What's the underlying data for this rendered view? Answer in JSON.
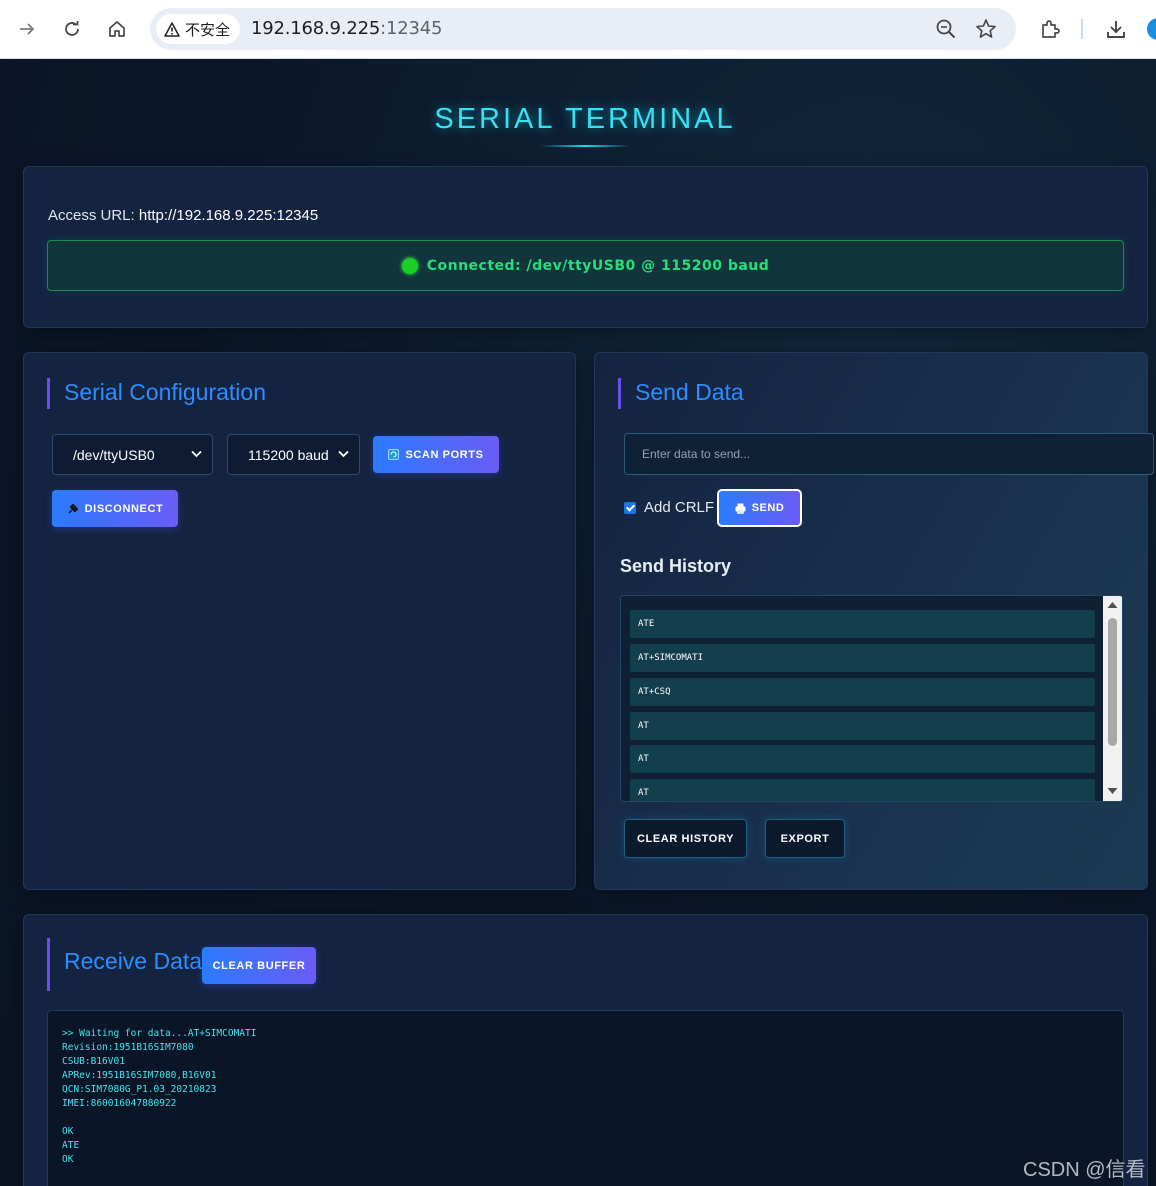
{
  "browser": {
    "insecure_label": "不安全",
    "url_host": "192.168.9.225",
    "url_port": ":12345"
  },
  "app": {
    "title": "SERIAL TERMINAL"
  },
  "access": {
    "label": "Access URL:",
    "url": "http://192.168.9.225:12345",
    "status": "Connected: /dev/ttyUSB0 @ 115200 baud",
    "status_color": "#1fe07a"
  },
  "config": {
    "title": "Serial Configuration",
    "port_value": "/dev/ttyUSB0",
    "baud_value": "115200 baud",
    "scan_label": "SCAN PORTS",
    "disconnect_label": "DISCONNECT"
  },
  "send": {
    "title": "Send Data",
    "placeholder": "Enter data to send...",
    "crlf_label": "Add CRLF",
    "crlf_checked": true,
    "send_label": "SEND",
    "history_title": "Send History",
    "history": [
      "ATE",
      "AT+SIMCOMATI",
      "AT+CSQ",
      "AT",
      "AT",
      "AT"
    ],
    "clear_history_label": "CLEAR HISTORY",
    "export_label": "EXPORT"
  },
  "receive": {
    "title": "Receive Data",
    "clear_label": "CLEAR BUFFER",
    "output": ">> Waiting for data...AT+SIMCOMATI\nRevision:1951B16SIM7080\nCSUB:B16V01\nAPRev:1951B16SIM7080,B16V01\nQCN:SIM7080G_P1.03_20210823\nIMEI:860016047880922\n\nOK\nATE\nOK"
  },
  "watermark": "CSDN @信看",
  "colors": {
    "accent_cyan": "#39e0f0",
    "accent_blue": "#2d8dff",
    "accent_purple": "#6b4df2",
    "background": "#0b1628"
  }
}
